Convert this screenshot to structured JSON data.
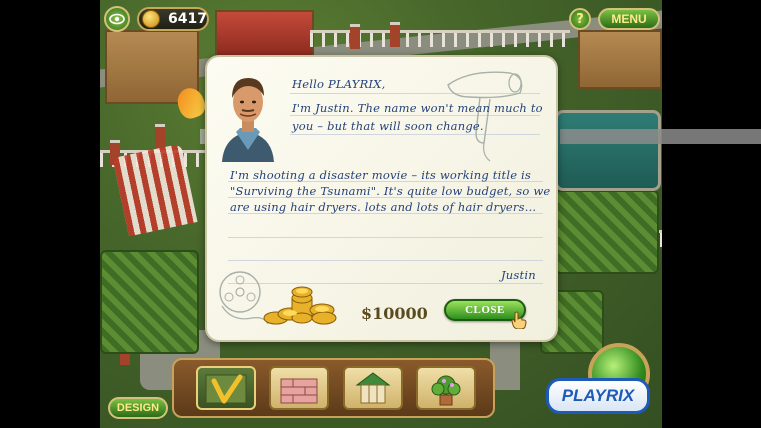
{
  "hud": {
    "coins": "6417",
    "help_label": "?",
    "menu_label": "MENU",
    "view_icon": "eye-icon"
  },
  "letter": {
    "greeting": "Hello PLAYRIX,",
    "paragraph1_line1": "I'm Justin. The name won't mean much to",
    "paragraph1_line2": "you  –  but  that  will  soon  change.",
    "paragraph2_line1": "I'm shooting a disaster movie – its working title is",
    "paragraph2_line2": "\"Surviving the Tsunami\". It's quite low budget, so we",
    "paragraph2_line3": "are using hair dryers. lots and lots of hair dryers...",
    "signature": "Justin",
    "reward": "$10000",
    "close_label": "CLOSE"
  },
  "bottom": {
    "design_label": "DESIGN",
    "brand": "PLAYRIX",
    "tools": [
      {
        "name": "check-tool-icon",
        "selected": true
      },
      {
        "name": "wall-tool-icon",
        "selected": false
      },
      {
        "name": "gazebo-tool-icon",
        "selected": false
      },
      {
        "name": "plant-tool-icon",
        "selected": false
      }
    ]
  },
  "colors": {
    "button_green": "#2f8e1d",
    "letter_ink": "#24427a",
    "gold": "#c9a25a"
  }
}
